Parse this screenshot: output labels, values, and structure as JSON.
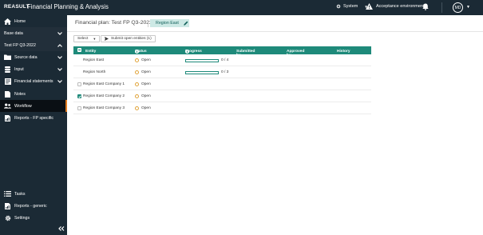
{
  "app": {
    "brand": "REASULT",
    "title": "Financial Planning & Analysis",
    "system_label": "System",
    "environment_label": "Acceptance environment",
    "user_initials": "MD"
  },
  "sidebar": {
    "items": [
      {
        "label": "Home",
        "icon": "home-icon"
      },
      {
        "label": "Base data",
        "icon": null,
        "chevron": "down"
      },
      {
        "label": "Test FP Q3-2022",
        "icon": null,
        "chevron": "up"
      },
      {
        "label": "Source data",
        "icon": "folder-icon",
        "chevron": "down"
      },
      {
        "label": "Input",
        "icon": "database-icon",
        "chevron": "down"
      },
      {
        "label": "Financial statements",
        "icon": "statements-icon",
        "chevron": "down"
      },
      {
        "label": "Notes",
        "icon": "notes-icon"
      },
      {
        "label": "Workflow",
        "icon": "workflow-icon"
      },
      {
        "label": "Reports - FP specific",
        "icon": "report-icon"
      },
      {
        "label": "Tasks",
        "icon": "tasks-icon"
      },
      {
        "label": "Reports - generic",
        "icon": "report-icon"
      },
      {
        "label": "Settings",
        "icon": "gear-icon"
      }
    ],
    "active_item": "Workflow"
  },
  "header": {
    "plan_title": "Financial plan: Test FP Q3-2022",
    "region_chip": "Region East"
  },
  "toolbar": {
    "select_label": "Select",
    "submit_label": "Submit open entities (1)"
  },
  "table": {
    "columns": [
      "Entity",
      "Status",
      "Progress",
      "Submitted by",
      "Approved by",
      "History"
    ],
    "rows": [
      {
        "entity": "Region East",
        "status": "Open",
        "progress_text": "0 / 4",
        "progress_fraction": 0.0,
        "has_checkbox": false,
        "checked": false,
        "indent": true
      },
      {
        "entity": "Region North",
        "status": "Open",
        "progress_text": "0 / 3",
        "progress_fraction": 0.0,
        "has_checkbox": false,
        "checked": false,
        "indent": true
      },
      {
        "entity": "Region East Company 1",
        "status": "Open",
        "progress_text": "",
        "progress_fraction": null,
        "has_checkbox": true,
        "checked": false,
        "indent": false
      },
      {
        "entity": "Region East Company 2",
        "status": "Open",
        "progress_text": "",
        "progress_fraction": null,
        "has_checkbox": true,
        "checked": true,
        "indent": false
      },
      {
        "entity": "Region East Company 3",
        "status": "Open",
        "progress_text": "",
        "progress_fraction": null,
        "has_checkbox": true,
        "checked": false,
        "indent": false
      }
    ]
  },
  "colors": {
    "sidebar_bg": "#1b2a35",
    "accent_teal": "#1e8a7a",
    "active_marker": "#e07b1f",
    "status_open": "#e0a43a"
  }
}
